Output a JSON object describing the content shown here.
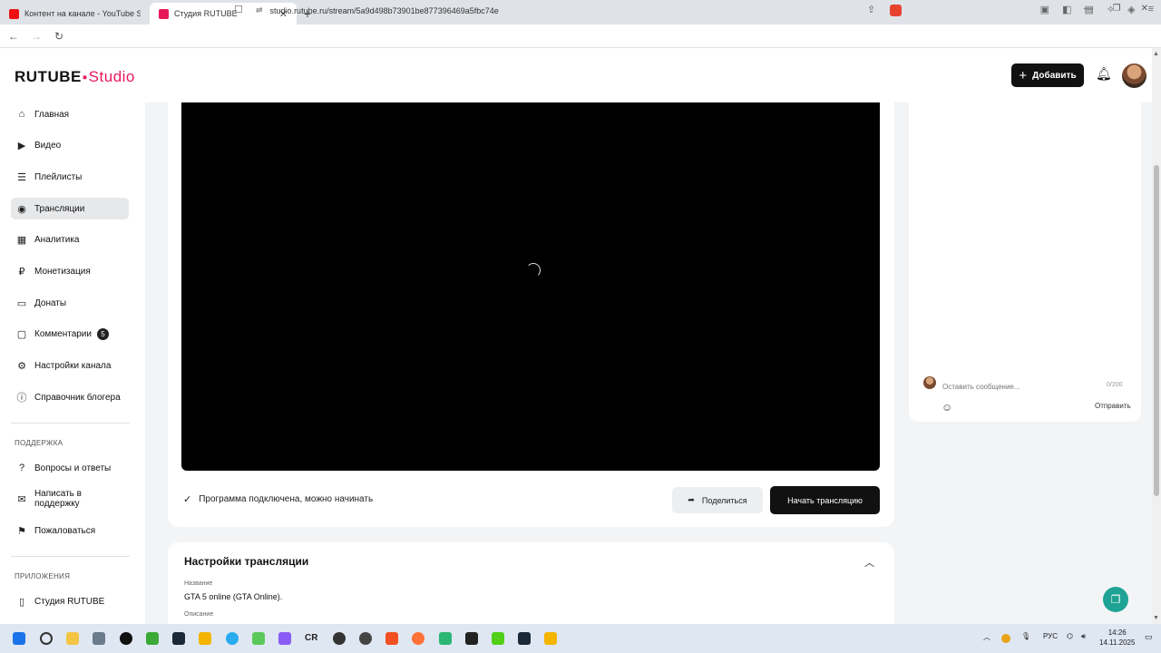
{
  "browser": {
    "tabs": [
      {
        "title": "Контент на канале - YouTube Studio",
        "active": false
      },
      {
        "title": "Студия RUTUBE",
        "active": true
      }
    ],
    "url": "studio.rutube.ru/stream/5a9d498b73901be877396469a5fbc74e"
  },
  "header": {
    "logo_brand": "RUTUBE",
    "logo_studio": "Studio",
    "add_label": "Добавить"
  },
  "sidebar": {
    "items": [
      {
        "label": "Главная",
        "icon": "home-icon"
      },
      {
        "label": "Видео",
        "icon": "video-icon"
      },
      {
        "label": "Плейлисты",
        "icon": "playlist-icon"
      },
      {
        "label": "Трансляции",
        "icon": "broadcast-icon"
      },
      {
        "label": "Аналитика",
        "icon": "analytics-icon"
      },
      {
        "label": "Монетизация",
        "icon": "monetization-icon"
      },
      {
        "label": "Донаты",
        "icon": "donate-icon"
      },
      {
        "label": "Комментарии",
        "icon": "comment-icon",
        "badge": "5"
      },
      {
        "label": "Настройки канала",
        "icon": "settings-icon"
      },
      {
        "label": "Справочник блогера",
        "icon": "info-icon"
      }
    ],
    "support_title": "ПОДДЕРЖКА",
    "support_items": [
      {
        "label": "Вопросы и ответы",
        "icon": "help-icon"
      },
      {
        "label": "Написать в поддержку",
        "icon": "mail-icon"
      },
      {
        "label": "Пожаловаться",
        "icon": "flag-icon"
      }
    ],
    "apps_title": "ПРИЛОЖЕНИЯ",
    "apps_items": [
      {
        "label": "Студия RUTUBE",
        "icon": "mobile-icon"
      }
    ]
  },
  "stream": {
    "status": "Программа подключена, можно начинать",
    "share_label": "Поделиться",
    "start_label": "Начать трансляцию"
  },
  "settings": {
    "title": "Настройки трансляции",
    "name_label": "Название",
    "name_value": "GTA 5 online (GTA Online).",
    "description_label": "Описание"
  },
  "chat": {
    "placeholder": "Оставить сообщение...",
    "counter": "0/200",
    "send_label": "Отправить"
  },
  "taskbar": {
    "lang": "РУС",
    "time": "14:26",
    "date": "14.11.2025",
    "cr_label": "CR"
  },
  "colors": {
    "accent": "#e8195a",
    "dark": "#111111",
    "fab": "#1fa394"
  }
}
